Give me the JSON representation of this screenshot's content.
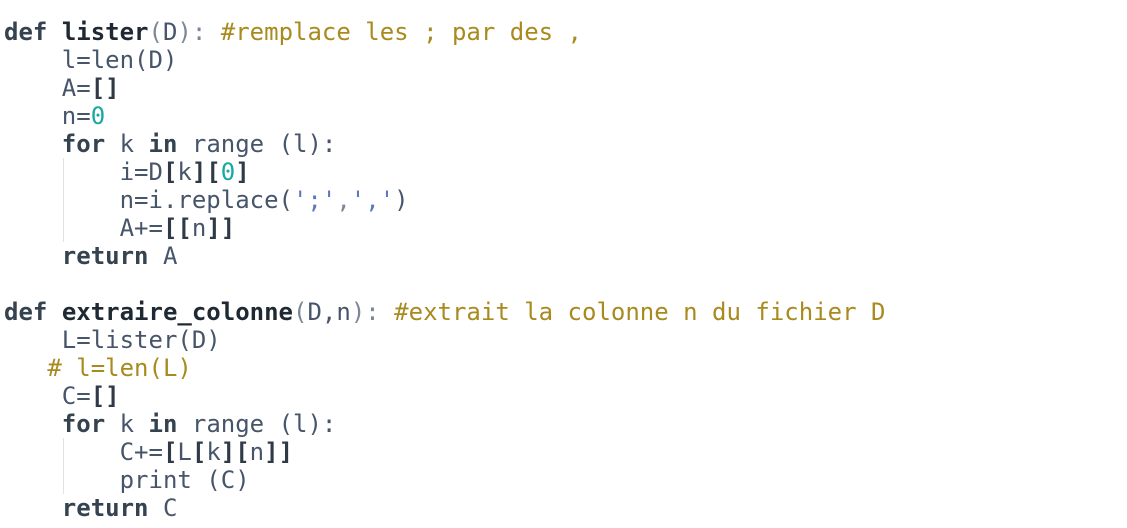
{
  "code": {
    "language": "python",
    "block1": {
      "l1": {
        "kw": "def",
        "name": "lister",
        "p_open": "(",
        "arg": "D",
        "p_close": "):",
        "comment": " #remplace les ; par des ,"
      },
      "l2": {
        "text": "l=len(D)"
      },
      "l3": {
        "var": "A=",
        "brackets": "[]"
      },
      "l4": {
        "var": "n=",
        "num": "0"
      },
      "l5": {
        "kw1": "for",
        "mid": " k ",
        "kw2": "in",
        "rest": " range (l):"
      },
      "l6": {
        "a": "i=D",
        "b1": "[",
        "k": "k",
        "b2": "][",
        "num": "0",
        "b3": "]"
      },
      "l7": {
        "a": "n=i.replace(",
        "s1": "';'",
        "comma": ",",
        "s2": "','",
        "close": ")"
      },
      "l8": {
        "a": "A+=",
        "b1": "[[",
        "n": "n",
        "b2": "]]"
      },
      "l9": {
        "kw": "return",
        "rest": " A"
      }
    },
    "block2": {
      "l1": {
        "kw": "def",
        "name": "extraire_colonne",
        "p_open": "(",
        "args": "D,n",
        "p_close": "):",
        "comment": " #extrait la colonne n du fichier D"
      },
      "l2": {
        "text": "L=lister(D)"
      },
      "l3": {
        "comment": "# l=len(L)"
      },
      "l4": {
        "var": "C=",
        "brackets": "[]"
      },
      "l5": {
        "kw1": "for",
        "mid": " k ",
        "kw2": "in",
        "rest": " range (l):"
      },
      "l6": {
        "a": "C+=",
        "b1": "[",
        "L": "L",
        "b2": "[",
        "k": "k",
        "b3": "][",
        "n": "n",
        "b4": "]]"
      },
      "l7": {
        "text": "print (C)"
      },
      "l8": {
        "kw": "return",
        "rest": " C"
      }
    }
  },
  "colors": {
    "keyword": "#35424f",
    "comment": "#a88a1e",
    "number": "#16a9a4",
    "string": "#5b77bd",
    "text": "#47556b"
  }
}
